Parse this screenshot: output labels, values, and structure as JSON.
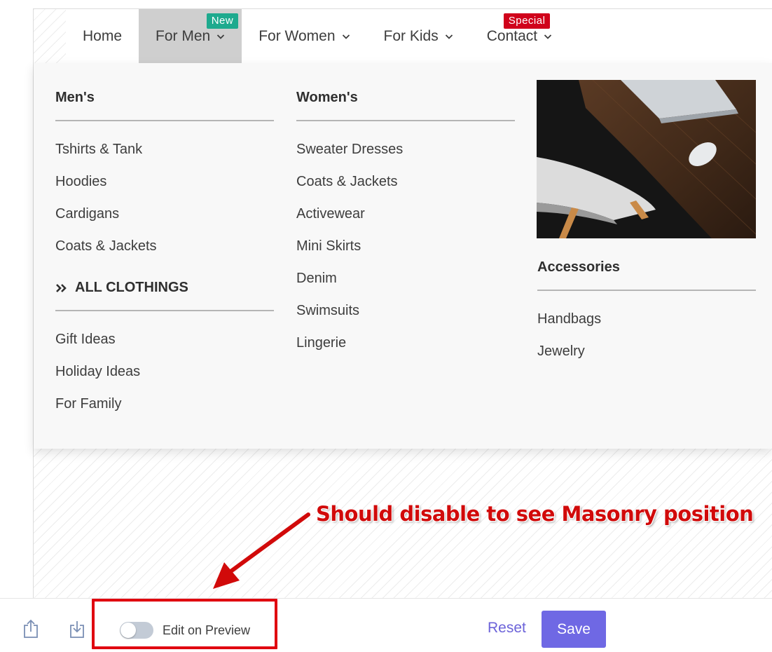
{
  "nav": {
    "items": [
      {
        "label": "Home"
      },
      {
        "label": "For Men",
        "badge": "New"
      },
      {
        "label": "For Women"
      },
      {
        "label": "For Kids"
      },
      {
        "label": "Contact",
        "badge": "Special"
      }
    ]
  },
  "megamenu": {
    "mens": {
      "heading": "Men's",
      "links": [
        "Tshirts & Tank",
        "Hoodies",
        "Cardigans",
        "Coats & Jackets"
      ],
      "all_heading": "ALL CLOTHINGS",
      "extra_links": [
        "Gift Ideas",
        "Holiday Ideas",
        "For Family"
      ]
    },
    "womens": {
      "heading": "Women's",
      "links": [
        "Sweater Dresses",
        "Coats & Jackets",
        "Activewear",
        "Mini Skirts",
        "Denim",
        "Swimsuits",
        "Lingerie"
      ]
    },
    "accessories": {
      "heading": "Accessories",
      "links": [
        "Handbags",
        "Jewelry"
      ]
    }
  },
  "annotation": {
    "text": "Should disable to see Masonry position"
  },
  "bottombar": {
    "toggle_label": "Edit on Preview",
    "toggle_on": false,
    "reset_label": "Reset",
    "save_label": "Save"
  },
  "colors": {
    "accent": "#6f68e4",
    "badge_new": "#1eaa8e",
    "badge_special": "#d0021b",
    "annotation": "#d10a0a"
  },
  "icons": [
    "export-icon",
    "import-icon",
    "chevron-down-icon",
    "double-chevron-right-icon"
  ]
}
